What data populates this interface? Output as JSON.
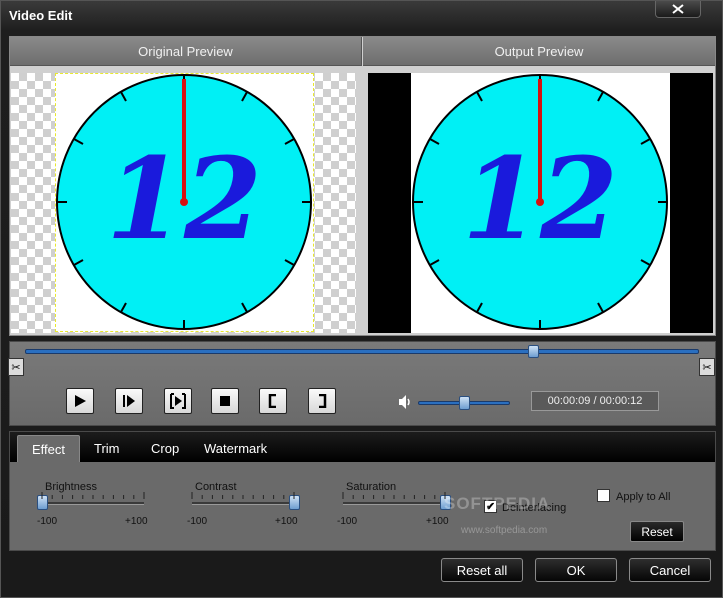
{
  "window": {
    "title": "Video Edit",
    "close_icon": "close-icon"
  },
  "preview": {
    "original_label": "Original Preview",
    "output_label": "Output Preview",
    "clock_text": "12",
    "colors": {
      "clock_face": "#00f0f5",
      "numerals": "#1a1adc",
      "hand": "#d81010"
    }
  },
  "timeline": {
    "position_percent": 75.4
  },
  "playback": {
    "buttons": [
      "play-icon",
      "step-forward-icon",
      "play-segment-icon",
      "stop-icon",
      "mark-in-icon",
      "mark-out-icon"
    ],
    "volume_percent": 50,
    "time": "00:00:09 / 00:00:12"
  },
  "tabs": [
    "Effect",
    "Trim",
    "Crop",
    "Watermark"
  ],
  "active_tab": "Effect",
  "effect": {
    "brightness": {
      "label": "Brightness",
      "min": "-100",
      "max": "+100",
      "value": -100
    },
    "contrast": {
      "label": "Contrast",
      "min": "-100",
      "max": "+100",
      "value": 100
    },
    "saturation": {
      "label": "Saturation",
      "min": "-100",
      "max": "+100",
      "value": 100
    },
    "deinterlacing": {
      "label": "Deinterlacing",
      "checked": true
    },
    "apply_to_all": {
      "label": "Apply to All",
      "checked": false
    },
    "reset_label": "Reset"
  },
  "watermark_overlay": {
    "brand": "SOFTPEDIA",
    "url": "www.softpedia.com"
  },
  "footer": {
    "reset_all": "Reset all",
    "ok": "OK",
    "cancel": "Cancel"
  },
  "accent_color": "#2a6fc0"
}
